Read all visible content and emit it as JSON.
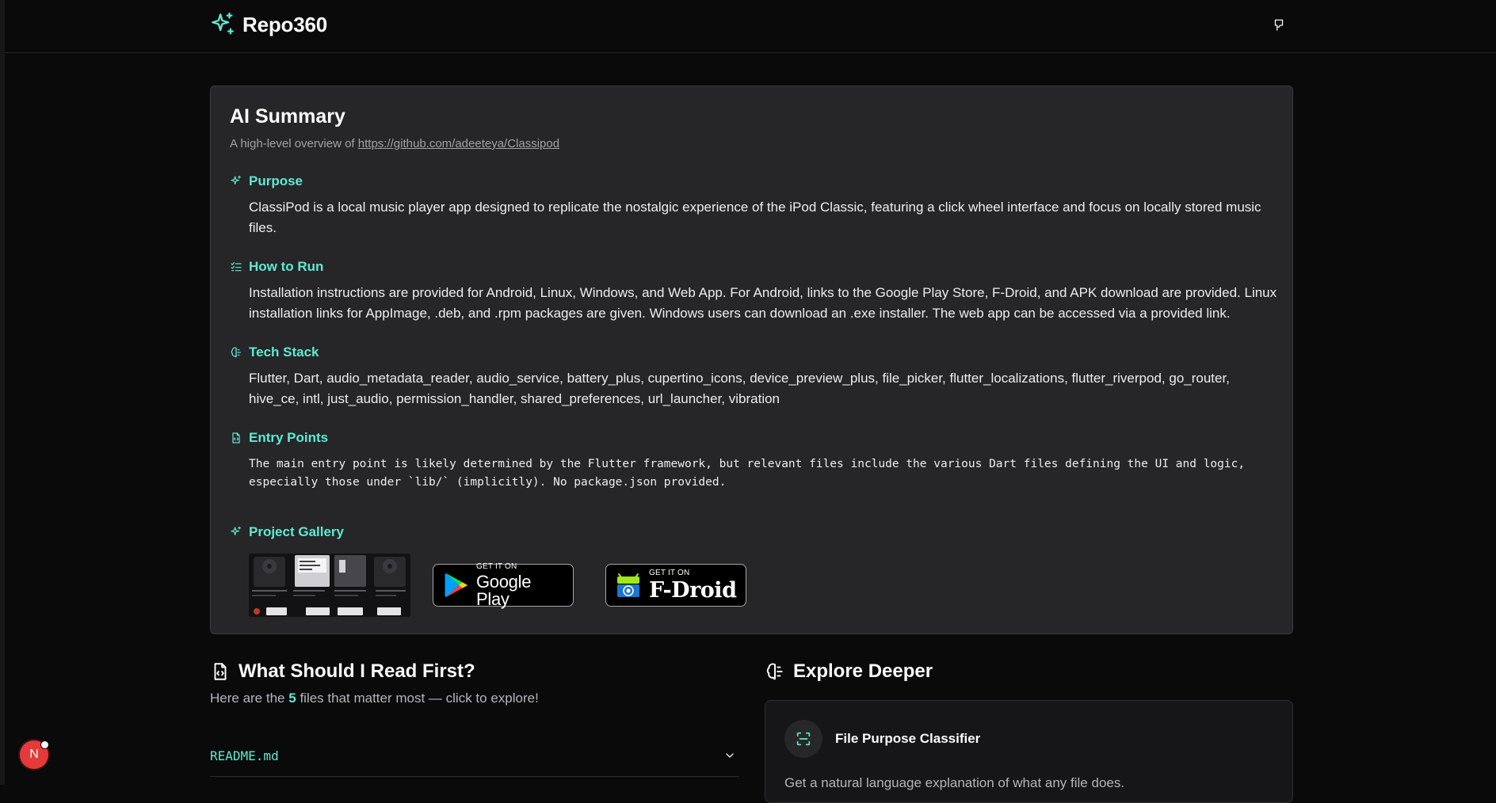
{
  "app": {
    "name": "Repo360",
    "accent": "#5eead4"
  },
  "header": {
    "github_icon": "github-icon"
  },
  "summary": {
    "title": "AI Summary",
    "subtitle_prefix": "A high-level overview of",
    "repo_url": "https://github.com/adeeteya/Classipod",
    "sections": {
      "purpose": {
        "icon": "sparkles-icon",
        "title": "Purpose",
        "body": "ClassiPod is a local music player app designed to replicate the nostalgic experience of the iPod Classic, featuring a click wheel interface and focus on locally stored music files."
      },
      "how_to_run": {
        "icon": "list-checks-icon",
        "title": "How to Run",
        "body": "Installation instructions are provided for Android, Linux, Windows, and Web App. For Android, links to the Google Play Store, F-Droid, and APK download are provided. Linux installation links for AppImage, .deb, and .rpm packages are given. Windows users can download an .exe installer. The web app can be accessed via a provided link."
      },
      "tech_stack": {
        "icon": "brain-icon",
        "title": "Tech Stack",
        "body": "Flutter, Dart, audio_metadata_reader, audio_service, battery_plus, cupertino_icons, device_preview_plus, file_picker, flutter_localizations, flutter_riverpod, go_router, hive_ce, intl, just_audio, permission_handler, shared_preferences, url_launcher, vibration"
      },
      "entry_points": {
        "icon": "file-code-icon",
        "title": "Entry Points",
        "body": "The main entry point is likely determined by the Flutter framework, but relevant files include the various Dart files defining the UI and logic, especially those under `lib/` (implicitly). No package.json provided."
      },
      "gallery": {
        "icon": "sparkles-icon",
        "title": "Project Gallery",
        "google_play": {
          "small": "GET IT ON",
          "big": "Google Play"
        },
        "fdroid": {
          "small": "GET IT ON",
          "big": "F-Droid"
        }
      }
    }
  },
  "read_first": {
    "title": "What Should I Read First?",
    "sub_before": "Here are the",
    "count": "5",
    "sub_after": "files that matter most — click to explore!",
    "files": [
      {
        "name": "README.md"
      }
    ]
  },
  "explore": {
    "title": "Explore Deeper",
    "tools": [
      {
        "title": "File Purpose Classifier",
        "desc": "Get a natural language explanation of what any file does."
      }
    ]
  },
  "user": {
    "initial": "N"
  }
}
